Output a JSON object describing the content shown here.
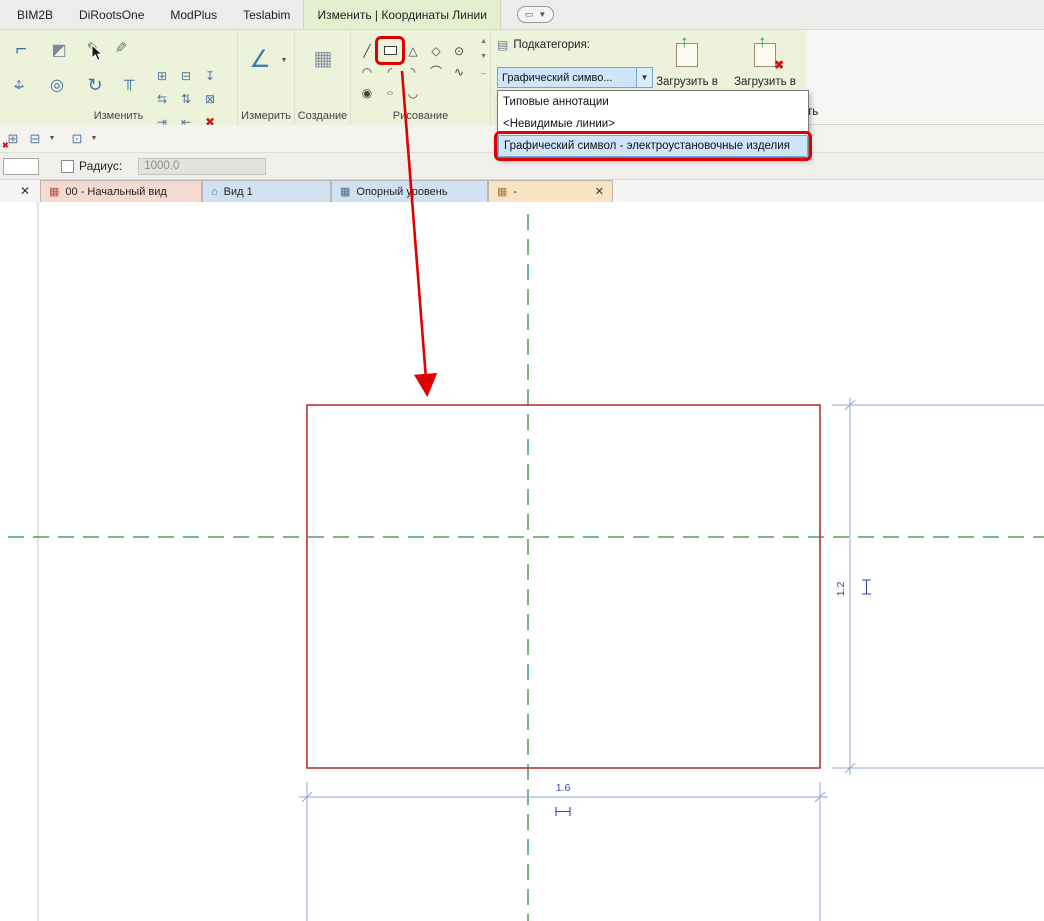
{
  "tabbar": {
    "tabs": [
      "BIM2B",
      "DiRootsOne",
      "ModPlus",
      "Teslabim",
      "Изменить | Координаты Линии"
    ]
  },
  "ribbon": {
    "panel_labels": [
      "Изменить",
      "Измерить",
      "Создание",
      "Рисование"
    ],
    "subcategory_label": "Подкатегория:",
    "subcategory_value": "Графический симво...",
    "subcategory_options": [
      "Типовые аннотации",
      "<Невидимые линии>",
      "Графический символ - электроустановочные изделия"
    ],
    "load_button_1": "Загрузить в",
    "load_button_2": "Загрузить в",
    "clipped_label": "ть"
  },
  "options_bar": {
    "radius_label": "Радиус:",
    "radius_value": "1000.0"
  },
  "view_tabs": {
    "tab_1": "00 - Начальный вид",
    "tab_2": "Вид 1",
    "tab_3": "Опорный уровень",
    "tab_4": "-"
  },
  "canvas": {
    "dim_vertical_value": "1.2",
    "dim_horizontal_value": "1.6"
  },
  "colors": {
    "annotation_red": "#e10000",
    "reference_green": "#2e8b3d",
    "sketch_red": "#b43434",
    "dimension_blue": "#90a5d6",
    "dimension_text_blue": "#3347a8"
  }
}
